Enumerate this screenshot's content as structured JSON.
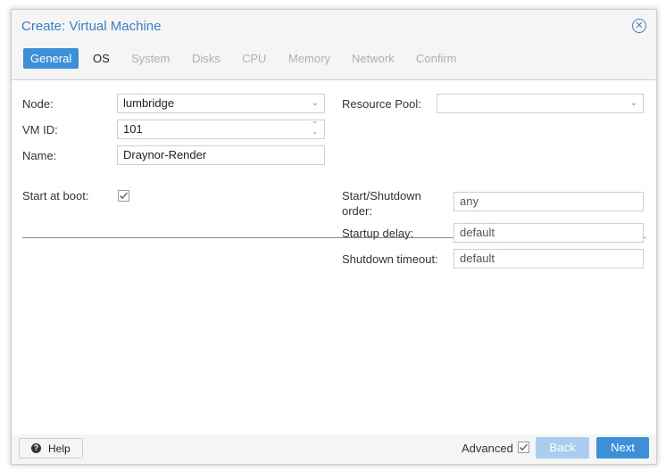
{
  "window": {
    "title": "Create: Virtual Machine"
  },
  "tabs": [
    {
      "label": "General",
      "state": "active"
    },
    {
      "label": "OS",
      "state": "enabled"
    },
    {
      "label": "System",
      "state": "disabled"
    },
    {
      "label": "Disks",
      "state": "disabled"
    },
    {
      "label": "CPU",
      "state": "disabled"
    },
    {
      "label": "Memory",
      "state": "disabled"
    },
    {
      "label": "Network",
      "state": "disabled"
    },
    {
      "label": "Confirm",
      "state": "disabled"
    }
  ],
  "general": {
    "node_label": "Node:",
    "node_value": "lumbridge",
    "vmid_label": "VM ID:",
    "vmid_value": "101",
    "name_label": "Name:",
    "name_value": "Draynor-Render",
    "resource_pool_label": "Resource Pool:",
    "resource_pool_value": ""
  },
  "advanced": {
    "start_at_boot_label": "Start at boot:",
    "start_at_boot_checked": true,
    "order_label_line1": "Start/Shutdown",
    "order_label_line2": "order:",
    "order_placeholder": "any",
    "startup_delay_label": "Startup delay:",
    "startup_delay_placeholder": "default",
    "shutdown_timeout_label": "Shutdown timeout:",
    "shutdown_timeout_placeholder": "default"
  },
  "footer": {
    "help_label": "Help",
    "advanced_label": "Advanced",
    "advanced_checked": true,
    "back_label": "Back",
    "next_label": "Next"
  },
  "colors": {
    "accent": "#3d8fd8",
    "title": "#3c7fc1",
    "disabled_button": "#a8cdee"
  }
}
